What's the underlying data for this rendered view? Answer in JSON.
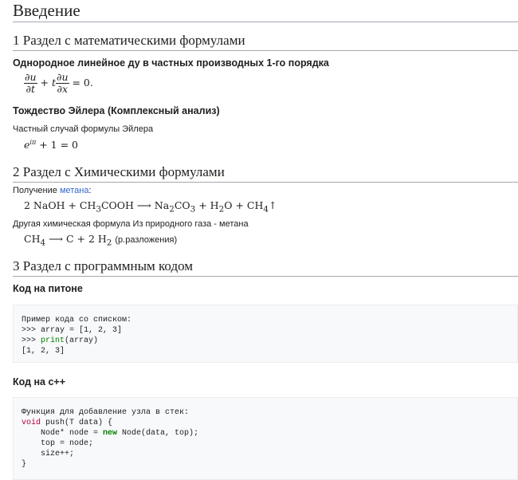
{
  "heading_intro": "Введение",
  "section1": {
    "title": "1 Раздел с математическими формулами",
    "sub1_title": "Однородное линейное ду в частных производных 1-го порядка",
    "eq1": {
      "du": "∂u",
      "dt": "∂t",
      "plus_t": "+ t",
      "dx": "∂x",
      "rhs": "= 0."
    },
    "sub2_title": "Тождество Эйлера (Комплексный анализ)",
    "sub2_text": "Частный случай формулы Эйлера",
    "eq2": {
      "base": "e",
      "exp": "iπ",
      "rest": "+ 1 = 0"
    }
  },
  "section2": {
    "title": "2 Раздел с Химическими формулами",
    "intro_prefix": "Получение ",
    "intro_link": "метана",
    "intro_suffix": ":",
    "reaction1": {
      "left": "2 NaOH + CH",
      "sub1": "3",
      "mid1": "COOH ⟶ Na",
      "sub2": "2",
      "mid2": "CO",
      "sub3": "3",
      "mid3": " + H",
      "sub4": "2",
      "mid4": "O + CH",
      "sub5": "4",
      "end": "↑"
    },
    "text2": "Другая химическая формула Из природного газа - метана",
    "reaction2": {
      "left": "CH",
      "sub1": "4",
      "mid": " ⟶ C + 2 H",
      "sub2": "2",
      "note": "(р.разложения)"
    }
  },
  "section3": {
    "title": "3 Раздел с программным кодом",
    "python_title": "Код на питоне",
    "python_code": {
      "line1": "Пример кода со списком:",
      "line2": ">>> array = [1, 2, 3]",
      "line3_prefix": ">>> ",
      "line3_kw": "print",
      "line3_rest": "(array)",
      "line4": "[1, 2, 3]"
    },
    "cpp_title": "Код на с++",
    "cpp_code": {
      "line1": "Функция для добавление узла в стек:",
      "line2_kw": "void",
      "line2_rest": " push(T data) {",
      "line3_prefix": "    Node* node = ",
      "line3_kw": "new",
      "line3_rest": " Node(data, top);",
      "line4": "    top = node;",
      "line5": "    size++;",
      "line6": "}"
    }
  }
}
